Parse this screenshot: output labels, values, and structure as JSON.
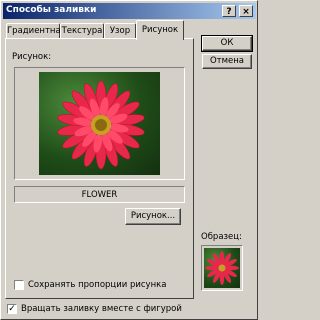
{
  "window": {
    "title": "Способы заливки",
    "help_symbol": "?",
    "close_symbol": "×"
  },
  "tabs": [
    {
      "label": "Градиентная"
    },
    {
      "label": "Текстура"
    },
    {
      "label": "Узор"
    },
    {
      "label": "Рисунок"
    }
  ],
  "panel": {
    "picture_label": "Рисунок:",
    "picture_name": "FLOWER",
    "select_picture_button": "Рисунок..."
  },
  "buttons": {
    "ok": "ОК",
    "cancel": "Отмена"
  },
  "sample_label": "Образец:",
  "checkboxes": {
    "keep_proportions": {
      "label": "Сохранять пропорции рисунка",
      "checked": false,
      "check_mark": ""
    },
    "rotate_with_shape": {
      "label": "Вращать заливку вместе с фигурой",
      "checked": true,
      "check_mark": "✓"
    }
  },
  "colors": {
    "title_start": "#0a246a",
    "title_end": "#a6caf0",
    "dialog_bg": "#d4d0c8",
    "flower": "#e8284a"
  }
}
